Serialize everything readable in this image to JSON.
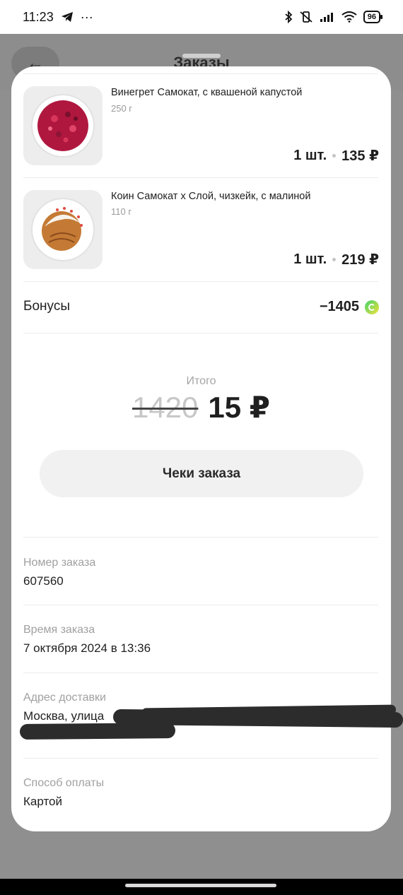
{
  "status_bar": {
    "time": "11:23",
    "more": "···",
    "battery": "96"
  },
  "background_header": {
    "title": "Заказы",
    "back_icon": "←"
  },
  "items": [
    {
      "name": "Винегрет Самокат, с квашеной капустой",
      "weight": "250 г",
      "quantity": "1 шт.",
      "price": "135 ₽"
    },
    {
      "name": "Коин Самокат х Слой, чизкейк, с малиной",
      "weight": "110 г",
      "quantity": "1 шт.",
      "price": "219 ₽"
    }
  ],
  "bonus": {
    "label": "Бонусы",
    "value": "−1405"
  },
  "total": {
    "label": "Итого",
    "old_value": "1420",
    "new_value": "15 ₽"
  },
  "receipt_button": "Чеки заказа",
  "order_info": {
    "number_label": "Номер заказа",
    "number_value": "607560",
    "time_label": "Время заказа",
    "time_value": "7 октября 2024 в 13:36",
    "address_label": "Адрес доставки",
    "address_value": "Москва, улица",
    "payment_label": "Способ оплаты",
    "payment_value": "Картой"
  },
  "colors": {
    "bonus_icon": "#3fd16b",
    "overlay": "#8f8f8f"
  }
}
